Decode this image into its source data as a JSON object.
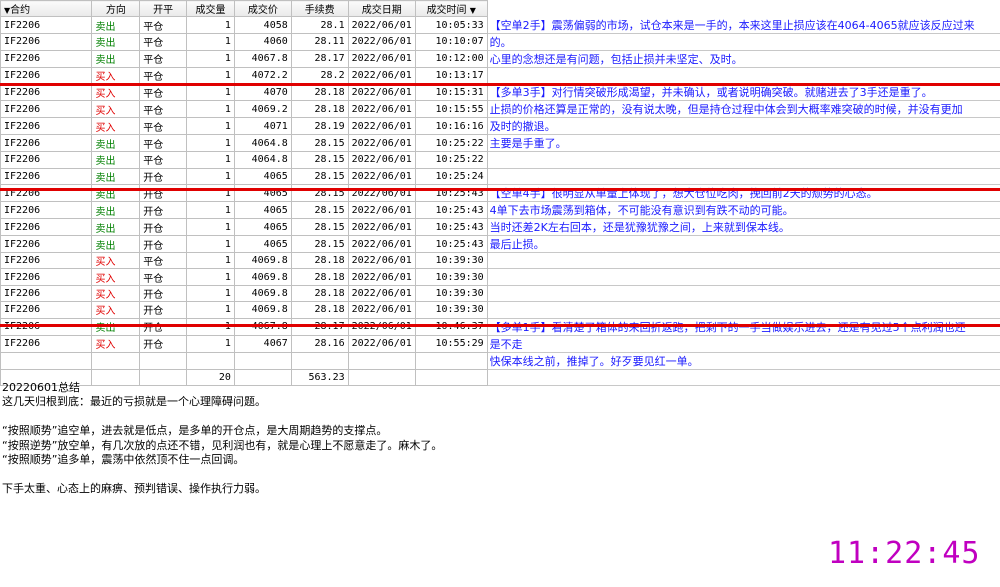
{
  "header": {
    "contract": "合约",
    "direction": "方向",
    "open_close": "开平",
    "volume": "成交量",
    "price": "成交价",
    "fee": "手续费",
    "date": "成交日期",
    "time": "成交时间"
  },
  "rows": [
    {
      "contract": "IF2206",
      "dir": "卖出",
      "oc": "平仓",
      "vol": "1",
      "price": "4058",
      "fee": "28.1",
      "date": "2022/06/01",
      "time": "10:05:33",
      "note": "【空单2手】震荡偏弱的市场，试仓本来是一手的，本来这里止损应该在4064-4065就应该反应过来"
    },
    {
      "contract": "IF2206",
      "dir": "卖出",
      "oc": "平仓",
      "vol": "1",
      "price": "4060",
      "fee": "28.11",
      "date": "2022/06/01",
      "time": "10:10:07",
      "note": "的。"
    },
    {
      "contract": "IF2206",
      "dir": "卖出",
      "oc": "平仓",
      "vol": "1",
      "price": "4067.8",
      "fee": "28.17",
      "date": "2022/06/01",
      "time": "10:12:00",
      "note": "心里的念想还是有问题，包括止损并未坚定、及时。"
    },
    {
      "contract": "IF2206",
      "dir": "买入",
      "oc": "平仓",
      "vol": "1",
      "price": "4072.2",
      "fee": "28.2",
      "date": "2022/06/01",
      "time": "10:13:17",
      "note": ""
    },
    {
      "contract": "IF2206",
      "dir": "买入",
      "oc": "平仓",
      "vol": "1",
      "price": "4070",
      "fee": "28.18",
      "date": "2022/06/01",
      "time": "10:15:31",
      "note": "【多单3手】对行情突破形成渴望，并未确认，或者说明确突破。就赌进去了3手还是重了。"
    },
    {
      "contract": "IF2206",
      "dir": "买入",
      "oc": "平仓",
      "vol": "1",
      "price": "4069.2",
      "fee": "28.18",
      "date": "2022/06/01",
      "time": "10:15:55",
      "note": "止损的价格还算是正常的，没有说太晚，但是持仓过程中体会到大概率难突破的时候，并没有更加"
    },
    {
      "contract": "IF2206",
      "dir": "买入",
      "oc": "平仓",
      "vol": "1",
      "price": "4071",
      "fee": "28.19",
      "date": "2022/06/01",
      "time": "10:16:16",
      "note": "及时的撤退。"
    },
    {
      "contract": "IF2206",
      "dir": "卖出",
      "oc": "平仓",
      "vol": "1",
      "price": "4064.8",
      "fee": "28.15",
      "date": "2022/06/01",
      "time": "10:25:22",
      "note": "主要是手重了。"
    },
    {
      "contract": "IF2206",
      "dir": "卖出",
      "oc": "平仓",
      "vol": "1",
      "price": "4064.8",
      "fee": "28.15",
      "date": "2022/06/01",
      "time": "10:25:22",
      "note": ""
    },
    {
      "contract": "IF2206",
      "dir": "卖出",
      "oc": "开仓",
      "vol": "1",
      "price": "4065",
      "fee": "28.15",
      "date": "2022/06/01",
      "time": "10:25:24",
      "note": ""
    },
    {
      "contract": "IF2206",
      "dir": "卖出",
      "oc": "开仓",
      "vol": "1",
      "price": "4065",
      "fee": "28.15",
      "date": "2022/06/01",
      "time": "10:25:43",
      "note": "【空单4手】很明显从单量上体现了，想大仓位吃肉，挽回前2天的颓势的心态。"
    },
    {
      "contract": "IF2206",
      "dir": "卖出",
      "oc": "开仓",
      "vol": "1",
      "price": "4065",
      "fee": "28.15",
      "date": "2022/06/01",
      "time": "10:25:43",
      "note": "4单下去市场震荡到箱体，不可能没有意识到有跌不动的可能。"
    },
    {
      "contract": "IF2206",
      "dir": "卖出",
      "oc": "开仓",
      "vol": "1",
      "price": "4065",
      "fee": "28.15",
      "date": "2022/06/01",
      "time": "10:25:43",
      "note": "当时还差2K左右回本，还是犹豫犹豫之间，上来就到保本线。"
    },
    {
      "contract": "IF2206",
      "dir": "卖出",
      "oc": "开仓",
      "vol": "1",
      "price": "4065",
      "fee": "28.15",
      "date": "2022/06/01",
      "time": "10:25:43",
      "note": "最后止损。"
    },
    {
      "contract": "IF2206",
      "dir": "买入",
      "oc": "平仓",
      "vol": "1",
      "price": "4069.8",
      "fee": "28.18",
      "date": "2022/06/01",
      "time": "10:39:30",
      "note": ""
    },
    {
      "contract": "IF2206",
      "dir": "买入",
      "oc": "平仓",
      "vol": "1",
      "price": "4069.8",
      "fee": "28.18",
      "date": "2022/06/01",
      "time": "10:39:30",
      "note": ""
    },
    {
      "contract": "IF2206",
      "dir": "买入",
      "oc": "开仓",
      "vol": "1",
      "price": "4069.8",
      "fee": "28.18",
      "date": "2022/06/01",
      "time": "10:39:30",
      "note": ""
    },
    {
      "contract": "IF2206",
      "dir": "买入",
      "oc": "开仓",
      "vol": "1",
      "price": "4069.8",
      "fee": "28.18",
      "date": "2022/06/01",
      "time": "10:39:30",
      "note": ""
    },
    {
      "contract": "IF2206",
      "dir": "卖出",
      "oc": "开仓",
      "vol": "1",
      "price": "4067.8",
      "fee": "28.17",
      "date": "2022/06/01",
      "time": "10:46:37",
      "note": "【多单1手】看清楚了箱体的来回折返跑，把剩下的一手当做娱乐进去，还是有见过5个点利润也还"
    },
    {
      "contract": "IF2206",
      "dir": "买入",
      "oc": "开仓",
      "vol": "1",
      "price": "4067",
      "fee": "28.16",
      "date": "2022/06/01",
      "time": "10:55:29",
      "note": "是不走"
    },
    {
      "contract": "",
      "dir": "",
      "oc": "",
      "vol": "",
      "price": "",
      "fee": "",
      "date": "",
      "time": "",
      "note": "快保本线之前，推掉了。好歹要见红一单。"
    }
  ],
  "totals": {
    "vol": "20",
    "fee": "563.23"
  },
  "summary": [
    "20220601总结",
    "这几天归根到底：最近的亏损就是一个心理障碍问题。",
    "",
    "“按照顺势”追空单，进去就是低点，是多单的开仓点，是大周期趋势的支撑点。",
    "“按照逆势”放空单，有几次放的点还不错，见利润也有，就是心理上不愿意走了。麻木了。",
    "“按照顺势”追多单，震荡中依然顶不住一点回调。",
    "",
    "下手太重、心态上的麻痹、预判错误、操作执行力弱。"
  ],
  "clock": "11:22:45",
  "colors": {
    "buy": "#e00000",
    "sell": "#008000",
    "note": "#1a1aff",
    "divider": "#e00000",
    "clock": "#c000c0"
  }
}
